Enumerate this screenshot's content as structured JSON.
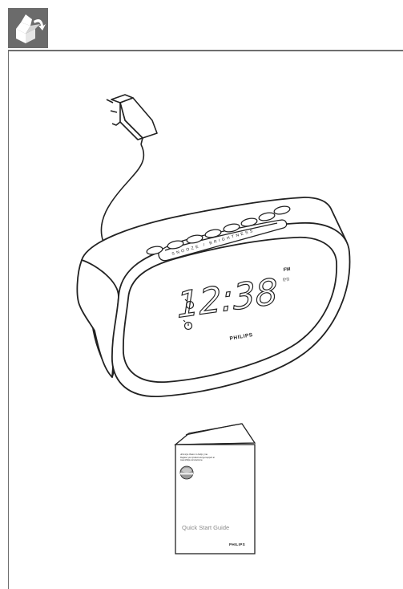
{
  "header": {
    "section_icon": "open-box-icon"
  },
  "clock": {
    "time_display": "12:38",
    "band_indicator": "FM",
    "radio_indicator": "((•))",
    "brand": "PHILIPS",
    "button_strip_labels": "SNOOZE / BRIGHTNESS",
    "alarm_1_icon": "alarm-1-icon",
    "alarm_2_icon": "alarm-2-icon"
  },
  "guide": {
    "tagline": "Always there to help you",
    "subtext_line_1": "Register your product and get support at",
    "subtext_line_2": "www.philips.com/welcome",
    "title": "Quick Start Guide",
    "brand": "PHILIPS"
  }
}
